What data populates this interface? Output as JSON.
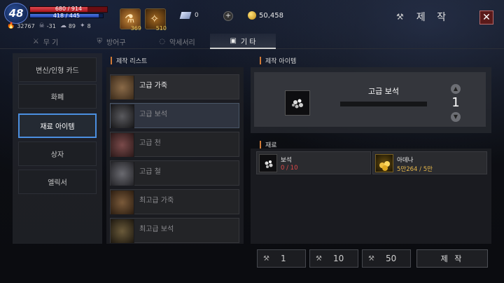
{
  "player": {
    "level": "48",
    "hp": "680 / 914",
    "hp_fraction": 0.744,
    "mp": "418 / 445",
    "mp_fraction": 0.939,
    "stats": [
      {
        "icon": "flame-icon",
        "value": "32767"
      },
      {
        "icon": "skull-icon",
        "value": "-31"
      },
      {
        "icon": "karma-icon",
        "value": "89"
      },
      {
        "icon": "pet-icon",
        "value": "8"
      }
    ]
  },
  "quick_slots": [
    {
      "icon": "potion-icon",
      "count": "369"
    },
    {
      "icon": "scroll-icon",
      "count": "510"
    }
  ],
  "currency": {
    "gem_count": "0",
    "plus": "+",
    "adena": "50,458"
  },
  "header": {
    "title": "제 작"
  },
  "tabs": [
    {
      "label": "무 기",
      "icon": "crossed-swords-icon"
    },
    {
      "label": "방어구",
      "icon": "armor-icon"
    },
    {
      "label": "악세서리",
      "icon": "ring-icon"
    },
    {
      "label": "기 타",
      "icon": "box-icon",
      "active": true
    }
  ],
  "categories": [
    "변신/인형 카드",
    "화폐",
    "재료 아이템",
    "상자",
    "엘릭서"
  ],
  "active_category": "재료 아이템",
  "craft_list": {
    "header": "제작 리스트",
    "items": [
      "고급 가죽",
      "고급 보석",
      "고급 천",
      "고급 철",
      "최고급 가죽",
      "최고급 보석"
    ]
  },
  "craft_item": {
    "header": "제작 아이템",
    "name": "고급 보석",
    "quantity": "1"
  },
  "materials": {
    "header": "재료",
    "items": [
      {
        "name": "보석",
        "count": "0 / 10",
        "count_color": "#e04848"
      },
      {
        "name": "아데나",
        "count": "5만264 / 5만",
        "count_color": "#e8b84a"
      }
    ]
  },
  "buttons": {
    "qty1": "1",
    "qty10": "10",
    "qty50": "50",
    "make": "제 작"
  }
}
